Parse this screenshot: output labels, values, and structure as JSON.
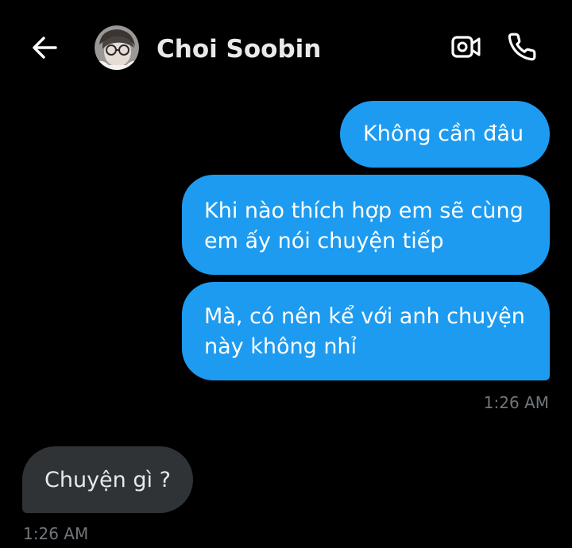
{
  "header": {
    "contact_name": "Choi Soobin",
    "back_icon": "arrow-left-icon",
    "video_icon": "video-camera-icon",
    "call_icon": "phone-icon"
  },
  "messages": [
    {
      "direction": "outgoing",
      "text": "Không cần đâu"
    },
    {
      "direction": "outgoing",
      "text": "Khi nào thích hợp em sẽ cùng em ấy nói chuyện tiếp"
    },
    {
      "direction": "outgoing",
      "text": "Mà, có nên kể với anh chuyện này không nhỉ"
    },
    {
      "direction": "incoming",
      "text": "Chuyện gì ?"
    }
  ],
  "timestamps": {
    "outgoing_group": "1:26 AM",
    "incoming_group": "1:26 AM"
  },
  "colors": {
    "background": "#000000",
    "outgoing_bubble": "#1d9bf0",
    "incoming_bubble": "#2f3336",
    "primary_text": "#e7e9ea",
    "secondary_text": "#71767b"
  }
}
